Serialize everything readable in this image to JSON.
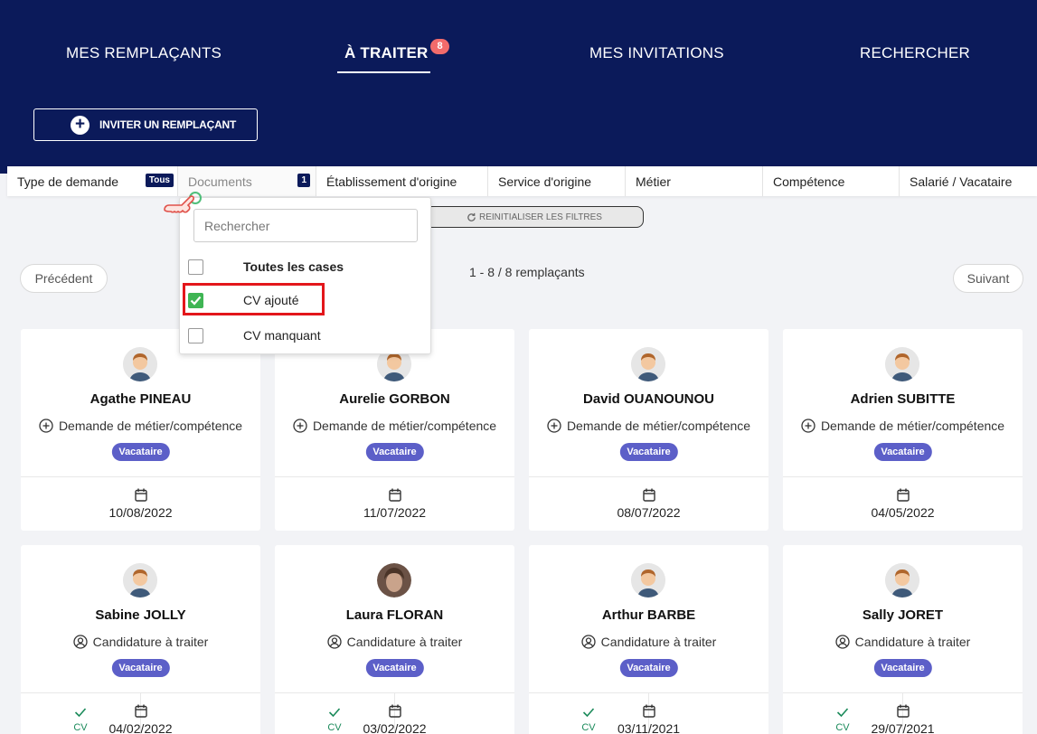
{
  "nav": {
    "items": [
      "MES REMPLAÇANTS",
      "À TRAITER",
      "MES INVITATIONS",
      "RECHERCHER"
    ],
    "active_badge": "8"
  },
  "invite_button": "INVITER UN REMPLAÇANT",
  "filters": {
    "type_demande": "Type de demande",
    "type_demande_badge": "Tous",
    "documents": "Documents",
    "documents_badge": "1",
    "etablissement": "Établissement d'origine",
    "service": "Service d'origine",
    "metier": "Métier",
    "competence": "Compétence",
    "salarie": "Salarié / Vacataire"
  },
  "reset_filters": "REINITIALISER LES FILTRES",
  "pagination": {
    "previous": "Précédent",
    "next": "Suivant",
    "count": "1 - 8 / 8 remplaçants"
  },
  "dropdown": {
    "search_placeholder": "Rechercher",
    "options": [
      {
        "label": "Toutes les cases",
        "checked": false
      },
      {
        "label": "CV ajouté",
        "checked": true
      },
      {
        "label": "CV manquant",
        "checked": false
      }
    ]
  },
  "cards": [
    {
      "name": "Agathe PINEAU",
      "request": "Demande de métier/compétence",
      "tag": "Vacataire",
      "date": "10/08/2022"
    },
    {
      "name": "Aurelie GORBON",
      "request": "Demande de métier/compétence",
      "tag": "Vacataire",
      "date": "11/07/2022"
    },
    {
      "name": "David OUANOUNOU",
      "request": "Demande de métier/compétence",
      "tag": "Vacataire",
      "date": "08/07/2022"
    },
    {
      "name": "Adrien SUBITTE",
      "request": "Demande de métier/compétence",
      "tag": "Vacataire",
      "date": "04/05/2022"
    },
    {
      "name": "Sabine JOLLY",
      "request": "Candidature à traiter",
      "tag": "Vacataire",
      "cv": "CV",
      "date": "04/02/2022"
    },
    {
      "name": "Laura FLORAN",
      "request": "Candidature à traiter",
      "tag": "Vacataire",
      "cv": "CV",
      "date": "03/02/2022"
    },
    {
      "name": "Arthur BARBE",
      "request": "Candidature à traiter",
      "tag": "Vacataire",
      "cv": "CV",
      "date": "03/11/2021"
    },
    {
      "name": "Sally JORET",
      "request": "Candidature à traiter",
      "tag": "Vacataire",
      "cv": "CV",
      "date": "29/07/2021"
    }
  ],
  "colors": {
    "header_bg": "#0b1a5a",
    "badge_red": "#f26b6b",
    "tag_purple": "#5c5fc8",
    "check_green": "#3fb554",
    "highlight_red": "#e3161b"
  },
  "icons": [
    "plus-circle-icon",
    "refresh-icon",
    "calendar-icon",
    "plus-circle-outline-icon",
    "user-circle-icon",
    "checkmark-icon",
    "pointing-hand-icon"
  ]
}
